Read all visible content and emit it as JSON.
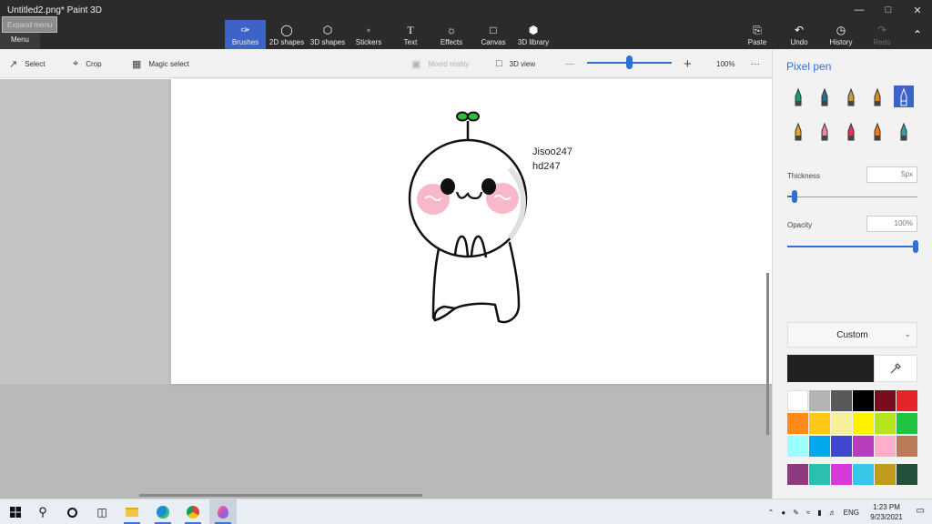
{
  "window": {
    "title": "Untitled2.png*  Paint 3D"
  },
  "menu": {
    "label": "Menu",
    "tooltip": "Expand menu"
  },
  "ribbon": {
    "tools": [
      {
        "label": "Brushes",
        "icon": "brush-icon",
        "active": true
      },
      {
        "label": "2D shapes",
        "icon": "shapes-2d-icon"
      },
      {
        "label": "3D shapes",
        "icon": "cube-icon"
      },
      {
        "label": "Stickers",
        "icon": "sticker-icon"
      },
      {
        "label": "Text",
        "icon": "text-icon"
      },
      {
        "label": "Effects",
        "icon": "sun-icon"
      },
      {
        "label": "Canvas",
        "icon": "canvas-icon"
      },
      {
        "label": "3D library",
        "icon": "library-icon"
      }
    ],
    "right": [
      {
        "label": "Paste",
        "icon": "paste-icon"
      },
      {
        "label": "Undo",
        "icon": "undo-icon"
      },
      {
        "label": "History",
        "icon": "history-icon"
      },
      {
        "label": "Redo",
        "icon": "redo-icon",
        "disabled": true
      }
    ]
  },
  "toolbar2": {
    "select": "Select",
    "crop": "Crop",
    "magic_select": "Magic select",
    "mixed_reality": "Mixed reality",
    "view_3d": "3D view",
    "zoom_minus": "—",
    "zoom_plus": "+",
    "zoom_level": "100%",
    "more": "···"
  },
  "canvas": {
    "signature_line1": "Jisoo247",
    "signature_line2": "hd247"
  },
  "panel": {
    "title": "Pixel pen",
    "thickness_label": "Thickness",
    "thickness_value": "5px",
    "opacity_label": "Opacity",
    "opacity_value": "100%",
    "custom_label": "Custom",
    "current_color": "#212121",
    "brushes": [
      {
        "name": "marker",
        "color": "#1a9c78"
      },
      {
        "name": "calligraphy-pen",
        "color": "#2a6f8f"
      },
      {
        "name": "oil-brush",
        "color": "#c89b3c"
      },
      {
        "name": "watercolor",
        "color": "#d68a2a"
      },
      {
        "name": "pixel-pen",
        "color": "#ffffff",
        "selected": true
      },
      {
        "name": "pencil",
        "color": "#e0a040"
      },
      {
        "name": "eraser",
        "color": "#e88a9a"
      },
      {
        "name": "crayon",
        "color": "#e0325a"
      },
      {
        "name": "spray-can",
        "color": "#f07a1a"
      },
      {
        "name": "fill",
        "color": "#3a9fa0"
      }
    ],
    "palette": [
      "#ffffff",
      "#b4b4b4",
      "#595959",
      "#000000",
      "#7a0d1d",
      "#e6242c",
      "#ff8a1a",
      "#ffc817",
      "#f7ef9b",
      "#fff100",
      "#b5e61d",
      "#21c440",
      "#99ffff",
      "#00a8ec",
      "#3f48cc",
      "#b83dba",
      "#ffaec9",
      "#b97a57"
    ],
    "custom_colors": [
      "#8e3a80",
      "#2bbfb0",
      "#d53bd9",
      "#37c6e8",
      "#bf9b1e",
      "#23503a"
    ]
  },
  "taskbar": {
    "lang": "ENG",
    "time": "1:23 PM",
    "date": "9/23/2021",
    "apps": [
      "windows-icon",
      "search-icon",
      "cortana-icon",
      "task-view-icon",
      "file-explorer-icon",
      "edge-icon",
      "chrome-icon",
      "paint3d-icon"
    ]
  }
}
